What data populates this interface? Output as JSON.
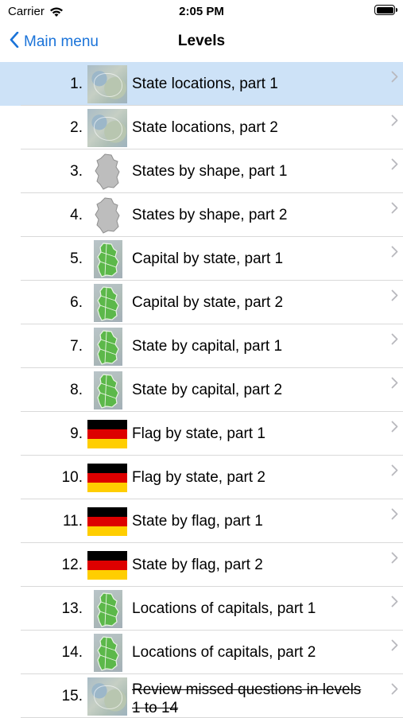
{
  "status": {
    "carrier": "Carrier",
    "time": "2:05 PM"
  },
  "nav": {
    "back_label": "Main menu",
    "title": "Levels"
  },
  "levels": [
    {
      "number": "1.",
      "label": "State locations, part 1",
      "thumb": "map",
      "selected": true
    },
    {
      "number": "2.",
      "label": "State locations, part 2",
      "thumb": "map"
    },
    {
      "number": "3.",
      "label": "States by shape, part 1",
      "thumb": "shape"
    },
    {
      "number": "4.",
      "label": "States by shape, part 2",
      "thumb": "shape"
    },
    {
      "number": "5.",
      "label": "Capital by state, part 1",
      "thumb": "greenmap"
    },
    {
      "number": "6.",
      "label": "Capital by state, part 2",
      "thumb": "greenmap"
    },
    {
      "number": "7.",
      "label": "State by capital, part 1",
      "thumb": "greenmap"
    },
    {
      "number": "8.",
      "label": "State by capital, part 2",
      "thumb": "greenmap"
    },
    {
      "number": "9.",
      "label": "Flag by state, part 1",
      "thumb": "flag"
    },
    {
      "number": "10.",
      "label": "Flag by state, part 2",
      "thumb": "flag"
    },
    {
      "number": "11.",
      "label": "State by flag, part 1",
      "thumb": "flag"
    },
    {
      "number": "12.",
      "label": "State by flag, part 2",
      "thumb": "flag"
    },
    {
      "number": "13.",
      "label": "Locations of capitals, part 1",
      "thumb": "greenmap"
    },
    {
      "number": "14.",
      "label": "Locations of capitals, part 2",
      "thumb": "greenmap"
    },
    {
      "number": "15.",
      "label": "Review missed questions in levels 1 to 14",
      "thumb": "map",
      "strikethrough": true
    }
  ],
  "colors": {
    "accent": "#1a73d9",
    "selected_row": "#cde2f7",
    "chevron": "#b8b8bd",
    "green": "#4caf3a"
  }
}
